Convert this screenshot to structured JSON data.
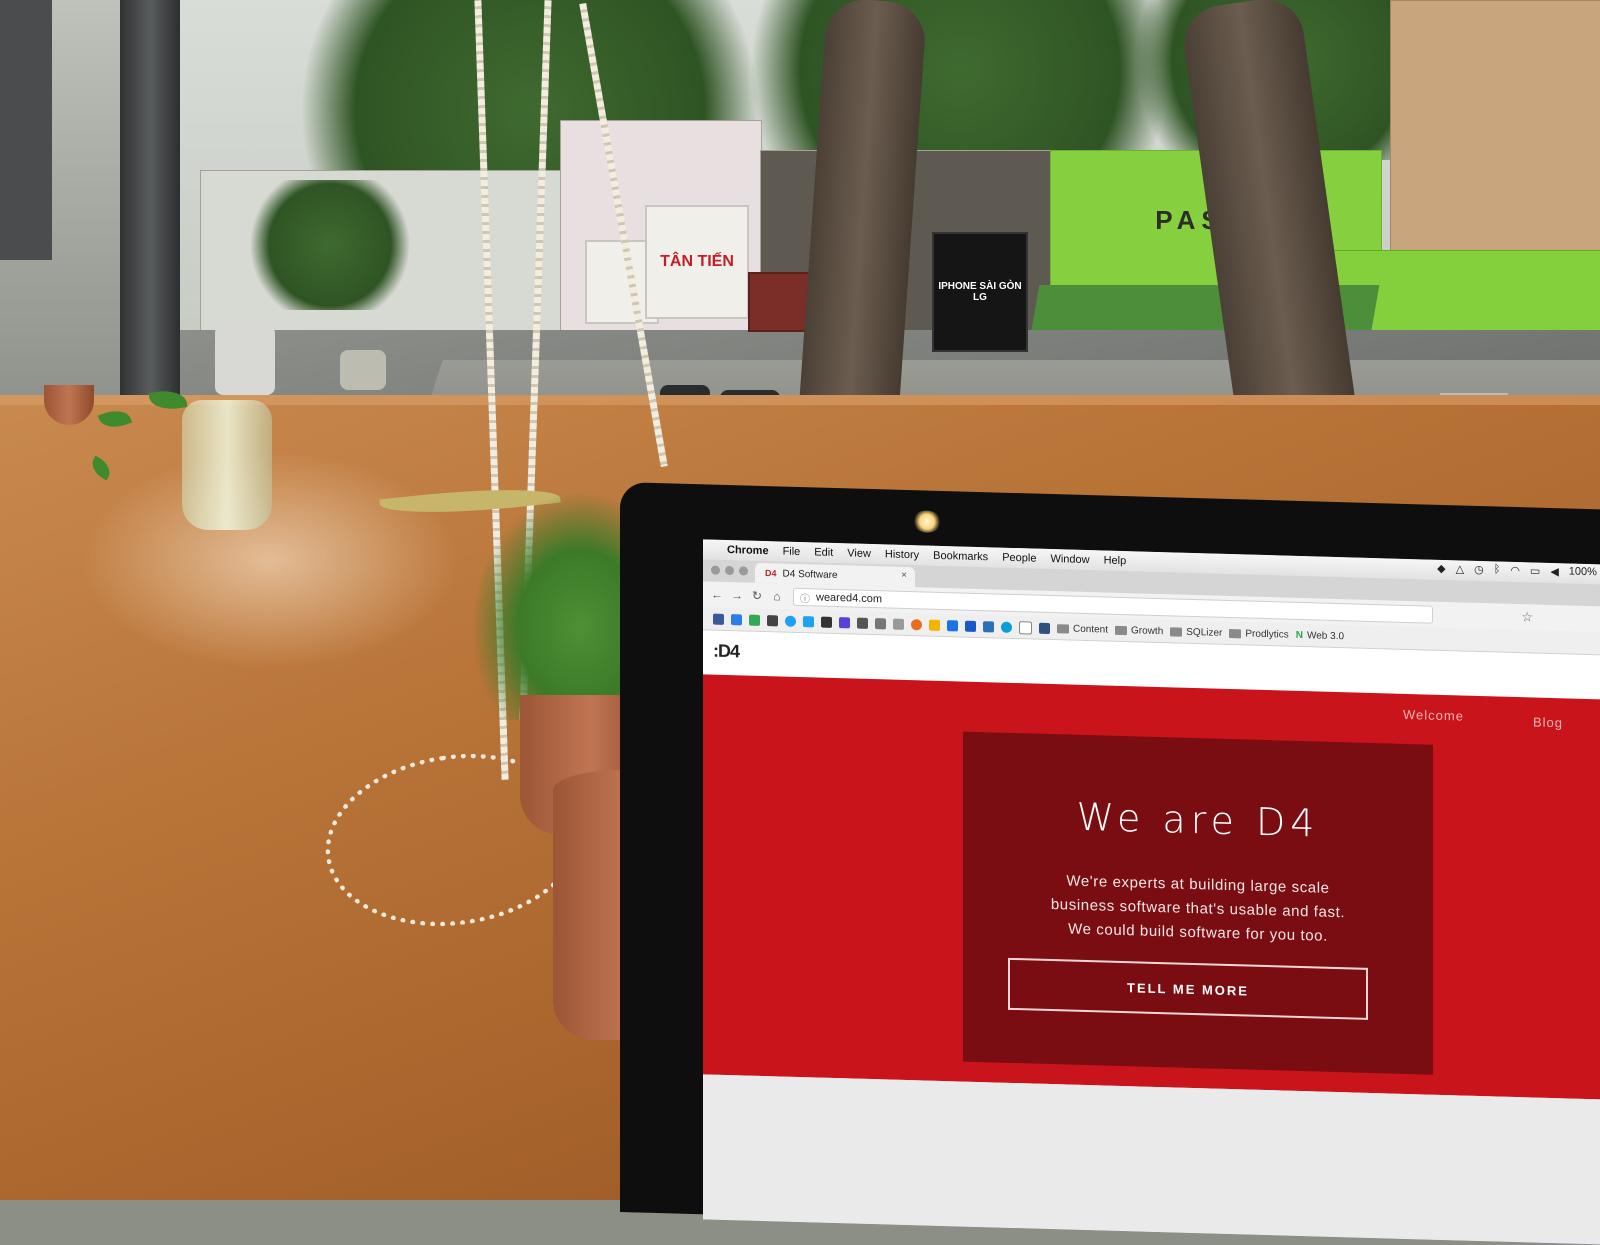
{
  "scene": {
    "signs": {
      "tan_tien": "TÂN TIẾN",
      "iphone": "IPHONE SÀI GÒN",
      "lg": "LG",
      "pas": "PAS"
    }
  },
  "menubar": {
    "app": "Chrome",
    "items": [
      "File",
      "Edit",
      "View",
      "History",
      "Bookmarks",
      "People",
      "Window",
      "Help"
    ],
    "battery": "100%"
  },
  "tab": {
    "title": "D4 Software",
    "close": "×"
  },
  "address": {
    "url": "weared4.com"
  },
  "bookmarks": {
    "folders": [
      "Content",
      "Growth",
      "SQLizer",
      "Prodlytics",
      "Web 3.0"
    ]
  },
  "page": {
    "logo": ":D4",
    "nav": [
      "Welcome",
      "Blog"
    ],
    "hero_title": "We are D4",
    "hero_lines": [
      "We're experts at building large scale",
      "business software that's usable and fast.",
      "We could build software for you too."
    ],
    "cta": "TELL ME MORE"
  },
  "colors": {
    "brand_red": "#c8141a",
    "hero_box": "#7a0d12"
  }
}
